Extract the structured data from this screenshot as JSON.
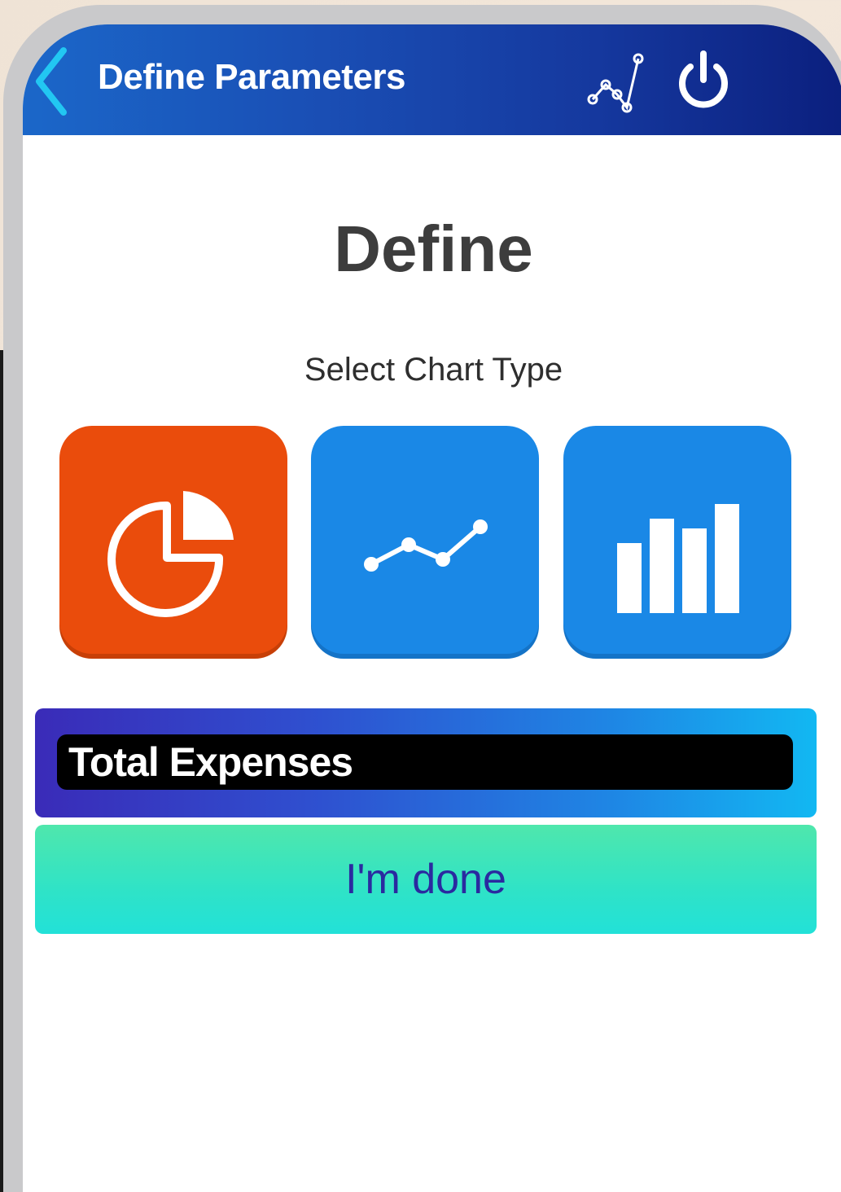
{
  "header": {
    "title": "Define Parameters",
    "back_icon": "chevron-left-icon",
    "chart_icon": "line-chart-icon",
    "power_icon": "power-icon",
    "gradient_colors": [
      "#1b67c9",
      "#0b1f7e"
    ]
  },
  "main": {
    "heading": "Define",
    "subheading": "Select Chart Type",
    "chart_types": [
      {
        "icon": "pie-chart-icon",
        "color": "#ea4c0c",
        "selected": true
      },
      {
        "icon": "line-chart-icon",
        "color": "#1a88e6",
        "selected": false
      },
      {
        "icon": "bar-chart-icon",
        "color": "#1a88e6",
        "selected": false
      }
    ],
    "chart_name": {
      "value": "Total Expenses"
    },
    "done_label": "I'm done"
  },
  "colors": {
    "accent_orange": "#ea4c0c",
    "accent_blue": "#1a88e6",
    "done_green": "#2fe3c7",
    "done_text": "#2a2aa0"
  }
}
